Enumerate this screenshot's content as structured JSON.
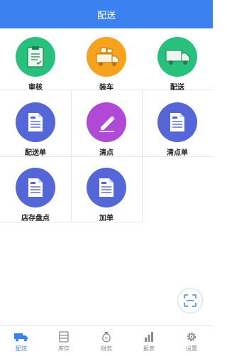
{
  "header": {
    "title": "配送"
  },
  "grid": {
    "items": [
      {
        "label": "审核",
        "icon": "clipboard-icon",
        "color": "#27c07c"
      },
      {
        "label": "装车",
        "icon": "loading-truck-icon",
        "color": "#f6a21d"
      },
      {
        "label": "配送",
        "icon": "delivery-truck-icon",
        "color": "#27c07c"
      },
      {
        "label": "配送单",
        "icon": "document-icon",
        "color": "#5566d6"
      },
      {
        "label": "清点",
        "icon": "pencil-icon",
        "color": "#b04ad6"
      },
      {
        "label": "清点单",
        "icon": "document-icon",
        "color": "#5566d6"
      },
      {
        "label": "店存盘点",
        "icon": "document-icon",
        "color": "#5566d6"
      },
      {
        "label": "加单",
        "icon": "document-icon",
        "color": "#5566d6"
      }
    ]
  },
  "scan_button": {
    "icon": "scan-icon"
  },
  "tabbar": {
    "tabs": [
      {
        "label": "配送",
        "icon": "truck-icon",
        "active": true
      },
      {
        "label": "库存",
        "icon": "inventory-icon",
        "active": false
      },
      {
        "label": "财务",
        "icon": "money-bag-icon",
        "active": false
      },
      {
        "label": "报表",
        "icon": "bar-chart-icon",
        "active": false
      },
      {
        "label": "设置",
        "icon": "gear-icon",
        "active": false
      }
    ]
  },
  "colors": {
    "accent": "#3b82f0",
    "green": "#27c07c",
    "orange": "#f6a21d",
    "blue": "#5566d6",
    "purple": "#b04ad6"
  }
}
